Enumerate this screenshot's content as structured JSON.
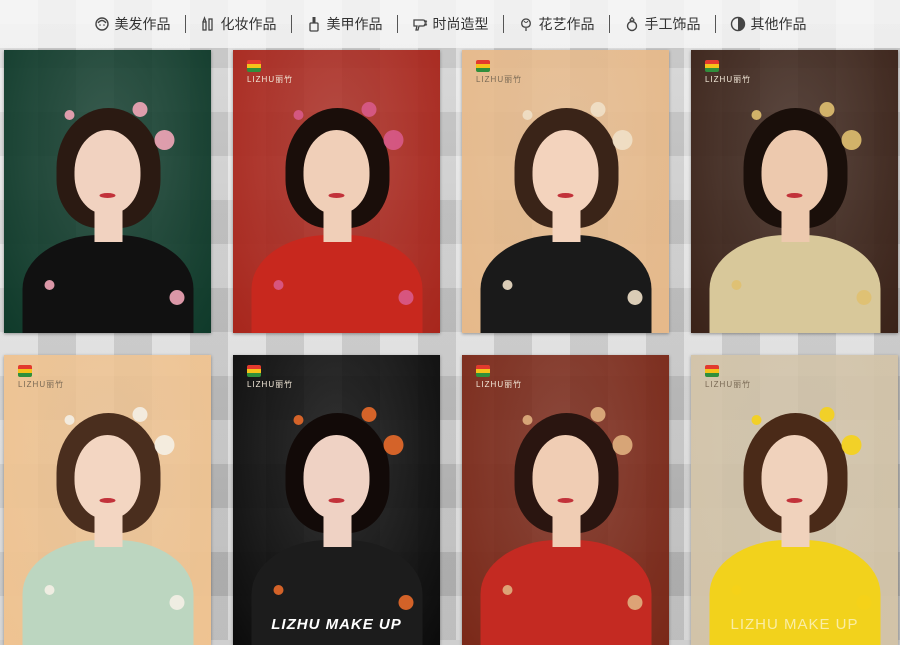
{
  "nav": {
    "items": [
      {
        "label": "美发作品",
        "icon": "hair-icon"
      },
      {
        "label": "化妆作品",
        "icon": "makeup-icon"
      },
      {
        "label": "美甲作品",
        "icon": "nail-polish-icon"
      },
      {
        "label": "时尚造型",
        "icon": "hair-dryer-icon"
      },
      {
        "label": "花艺作品",
        "icon": "flower-icon"
      },
      {
        "label": "手工饰品",
        "icon": "ring-icon"
      },
      {
        "label": "其他作品",
        "icon": "half-circle-icon"
      }
    ]
  },
  "gallery": {
    "logo_text": "LIZHU丽竹",
    "cards": [
      {
        "bg": "#0f3a2a",
        "skin": "#f1d2c0",
        "hair": "#2b1a12",
        "body": "#111111",
        "accent": "#f2a6b8",
        "logo": false,
        "brand": ""
      },
      {
        "bg": "#a8261c",
        "skin": "#f0cfb8",
        "hair": "#1a0e0a",
        "body": "#c8281e",
        "accent": "#d85a8a",
        "logo": true,
        "brand": ""
      },
      {
        "bg": "#e6b98a",
        "skin": "#f3d3bd",
        "hair": "#3a2418",
        "body": "#1a1a1a",
        "accent": "#f0e0c8",
        "logo": true,
        "brand": ""
      },
      {
        "bg": "#3a2218",
        "skin": "#edc9ae",
        "hair": "#1a0f0a",
        "body": "#d8c89a",
        "accent": "#e0c070",
        "logo": true,
        "brand": ""
      },
      {
        "bg": "#efc391",
        "skin": "#f3d6c2",
        "hair": "#4a2e1e",
        "body": "#bcd6c0",
        "accent": "#f4f0e6",
        "logo": true,
        "brand": ""
      },
      {
        "bg": "#0b0b0b",
        "skin": "#efd2c4",
        "hair": "#120a08",
        "body": "#1c1c1c",
        "accent": "#e86a2a",
        "logo": true,
        "brand": "LIZHU  MAKE UP"
      },
      {
        "bg": "#7a2818",
        "skin": "#f0cdb4",
        "hair": "#2a1510",
        "body": "#c42a22",
        "accent": "#e0b080",
        "logo": true,
        "brand": ""
      },
      {
        "bg": "#d2c3a8",
        "skin": "#f0d2bc",
        "hair": "#4a2a18",
        "body": "#f2d21c",
        "accent": "#f5d21a",
        "logo": true,
        "brand": "LIZHU  MAKE UP"
      }
    ]
  }
}
